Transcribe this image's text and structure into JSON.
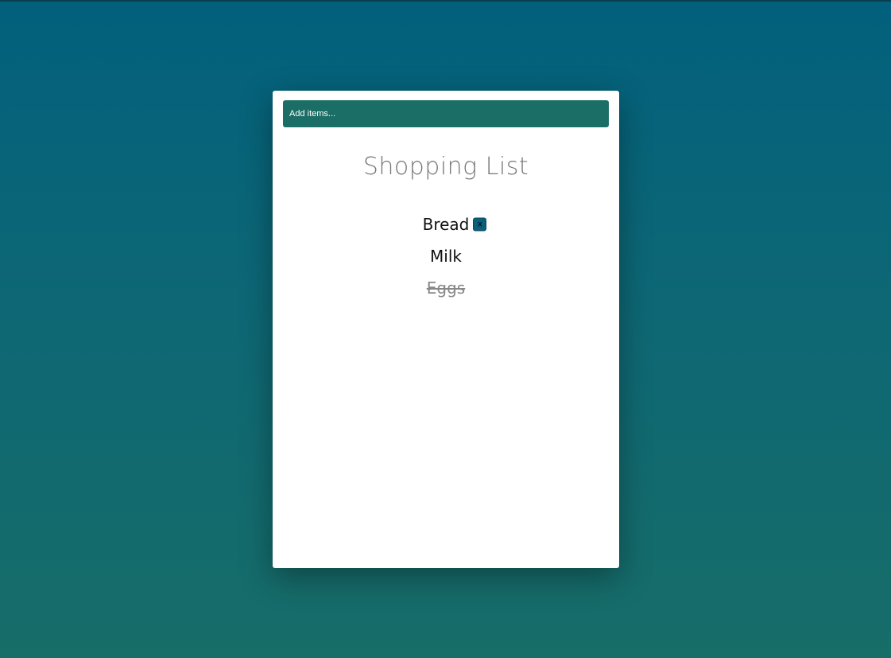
{
  "input": {
    "placeholder": "Add items..."
  },
  "title": "Shopping List",
  "items": [
    {
      "label": "Bread",
      "done": false,
      "delete_label": "x"
    },
    {
      "label": "Milk",
      "done": false
    },
    {
      "label": "Eggs",
      "done": true
    }
  ],
  "colors": {
    "background_top": "#02607c",
    "background_bottom": "#176d68",
    "input_bg": "#1a6e66",
    "delete_button_bg": "#0b5f7a",
    "title": "#777777",
    "done_text": "#888888"
  }
}
